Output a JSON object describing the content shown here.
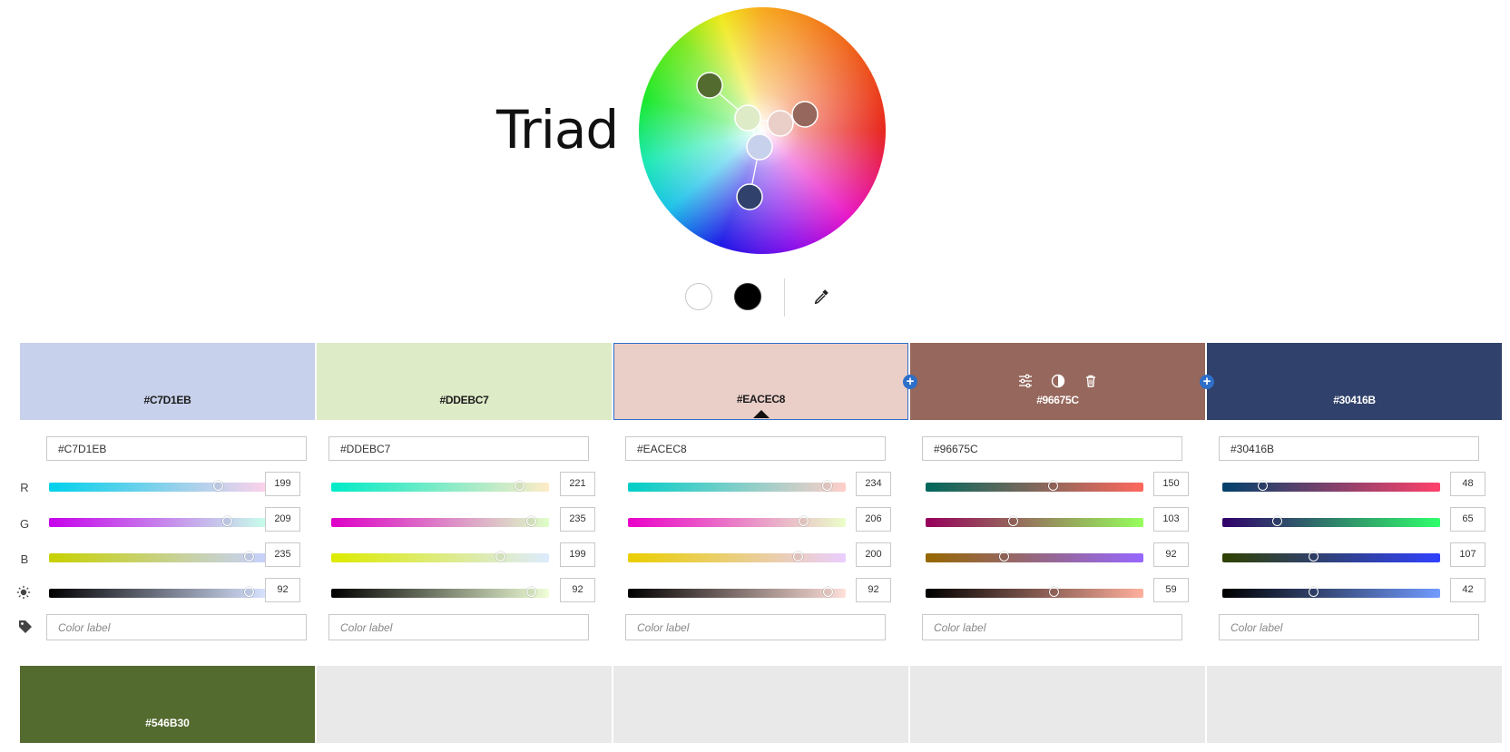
{
  "rule_title": "Triad",
  "wheel": {
    "handles": [
      {
        "color": "#546B30"
      },
      {
        "color": "#DDEBC7"
      },
      {
        "color": "#EACEC8"
      },
      {
        "color": "#96675C"
      },
      {
        "color": "#C7D1EB"
      },
      {
        "color": "#30416B"
      }
    ]
  },
  "tools": {
    "white_icon": "white-circle-icon",
    "black_icon": "black-circle-icon",
    "eyedropper_icon": "eyedropper-icon"
  },
  "row_labels": {
    "r": "R",
    "g": "G",
    "b": "B",
    "brightness_icon": "sun-icon",
    "label_icon": "tag-icon"
  },
  "swatch_tools": [
    "sliders-icon",
    "contrast-icon",
    "trash-icon"
  ],
  "color_label_placeholder": "Color label",
  "swatches": [
    {
      "hex": "#C7D1EB",
      "color": "#C7D1EB",
      "text_color": "#1b1b1b",
      "r": "199",
      "g": "209",
      "b": "235",
      "brightness": "92",
      "selected": false
    },
    {
      "hex": "#DDEBC7",
      "color": "#DDEBC7",
      "text_color": "#1b1b1b",
      "r": "221",
      "g": "235",
      "b": "199",
      "brightness": "92",
      "selected": false
    },
    {
      "hex": "#EACEC8",
      "color": "#EACEC8",
      "text_color": "#1b1b1b",
      "r": "234",
      "g": "206",
      "b": "200",
      "brightness": "92",
      "selected": true
    },
    {
      "hex": "#96675C",
      "color": "#96675C",
      "text_color": "#ffffff",
      "r": "150",
      "g": "103",
      "b": "92",
      "brightness": "59",
      "selected": false
    },
    {
      "hex": "#30416B",
      "color": "#30416B",
      "text_color": "#ffffff",
      "r": "48",
      "g": "65",
      "b": "107",
      "brightness": "42",
      "selected": false
    }
  ],
  "lower_row": [
    {
      "hex": "#546B30",
      "color": "#546B30"
    },
    {
      "hex": "",
      "color": "#E9E9E9"
    },
    {
      "hex": "",
      "color": "#E9E9E9"
    },
    {
      "hex": "",
      "color": "#E9E9E9"
    },
    {
      "hex": "",
      "color": "#E9E9E9"
    }
  ]
}
